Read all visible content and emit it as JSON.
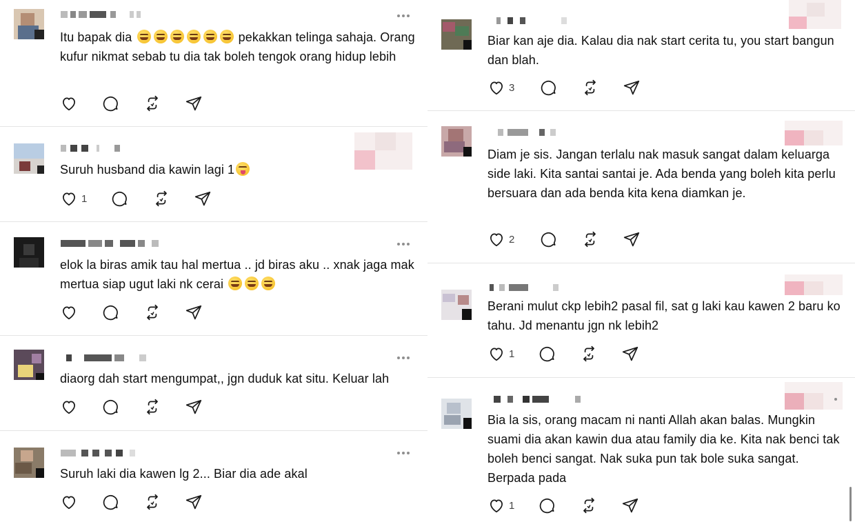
{
  "left_posts": [
    {
      "text": "Itu bapak dia",
      "emojis": 6,
      "text_after": "pekakkan telinga sahaja. Orang kufur nikmat sebab tu dia tak boleh tengok orang hidup lebih",
      "likes": ""
    },
    {
      "text": "Suruh husband dia kawin lagi 1",
      "emojis": 1,
      "text_after": "",
      "likes": "1"
    },
    {
      "text": "elok la biras amik tau hal mertua .. jd biras aku .. xnak jaga mak mertua siap ugut laki nk cerai",
      "emojis": 3,
      "text_after": "",
      "likes": ""
    },
    {
      "text": "diaorg dah start mengumpat,, jgn duduk kat situ. Keluar lah",
      "emojis": 0,
      "text_after": "",
      "likes": ""
    },
    {
      "text": "Suruh laki dia kawen lg 2... Biar dia ade akal",
      "emojis": 0,
      "text_after": "",
      "likes": ""
    }
  ],
  "right_posts": [
    {
      "text": "Biar kan aje dia. Kalau dia nak start cerita tu, you start bangun dan blah.",
      "likes": "3"
    },
    {
      "text": "Diam je sis. Jangan terlalu nak masuk sangat dalam keluarga side laki. Kita santai santai je. Ada benda yang boleh kita perlu bersuara dan ada benda kita kena diamkan je.",
      "likes": "2"
    },
    {
      "text": "Berani mulut ckp lebih2 pasal fil, sat g laki kau kawen 2 baru ko tahu. Jd menantu jgn nk lebih2",
      "likes": "1"
    },
    {
      "text": "Bia la sis, orang macam ni nanti Allah akan balas. Mungkin suami dia akan kawin dua atau family dia ke. Kita nak benci tak boleh benci sangat. Nak suka pun tak bole suka sangat. Berpada pada",
      "likes": "1"
    }
  ],
  "icons": {
    "like": "heart-icon",
    "reply": "comment-icon",
    "repost": "repost-icon",
    "share": "send-icon",
    "more": "more-icon"
  },
  "colors": {
    "text": "#101010",
    "icon": "#1a1a1a",
    "divider": "#e4e4e4",
    "count": "#444444"
  }
}
